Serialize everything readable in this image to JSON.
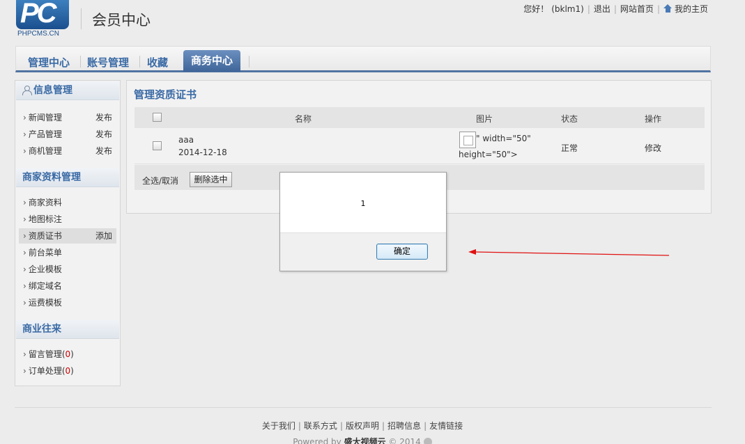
{
  "header": {
    "logo_text": "PC",
    "logo_sub": "PHPCMS.CN",
    "title": "会员中心",
    "greeting": "您好！",
    "username": "(bklm1)",
    "logout": "退出",
    "site_home": "网站首页",
    "my_home": "我的主页"
  },
  "nav": {
    "items": [
      {
        "label": "管理中心"
      },
      {
        "label": "账号管理"
      },
      {
        "label": "收藏"
      },
      {
        "label": "商务中心"
      }
    ]
  },
  "sidebar": {
    "section1": {
      "title": "信息管理",
      "items": [
        {
          "label": "新闻管理",
          "action": "发布"
        },
        {
          "label": "产品管理",
          "action": "发布"
        },
        {
          "label": "商机管理",
          "action": "发布"
        }
      ]
    },
    "section2": {
      "title": "商家资料管理",
      "items": [
        {
          "label": "商家资料"
        },
        {
          "label": "地图标注"
        },
        {
          "label": "资质证书",
          "action": "添加"
        },
        {
          "label": "前台菜单"
        },
        {
          "label": "企业模板"
        },
        {
          "label": "绑定域名"
        },
        {
          "label": "运费模板"
        }
      ]
    },
    "section3": {
      "title": "商业往来",
      "items": [
        {
          "label": "留言管理",
          "count": "0"
        },
        {
          "label": "订单处理",
          "count": "0"
        }
      ]
    }
  },
  "main": {
    "title": "管理资质证书",
    "columns": {
      "name": "名称",
      "image": "图片",
      "status": "状态",
      "op": "操作"
    },
    "rows": [
      {
        "name": "aaa",
        "date": "2014-12-18",
        "image_text_1": "\" width=\"50\"",
        "image_text_2": "height=\"50\">",
        "status": "正常",
        "op": "修改"
      }
    ],
    "select_all": "全选/取消",
    "delete_button": "删除选中"
  },
  "dialog": {
    "message": "1",
    "ok": "确定"
  },
  "footer": {
    "links": [
      "关于我们",
      "联系方式",
      "版权声明",
      "招聘信息",
      "友情链接"
    ],
    "powered_prefix": "Powered by ",
    "powered_brand": "盛大视频云",
    "powered_suffix": " © 2014"
  },
  "colors": {
    "accent": "#3a6aa5",
    "tab_active": "#4f73a1",
    "arrow": "#e01010"
  }
}
